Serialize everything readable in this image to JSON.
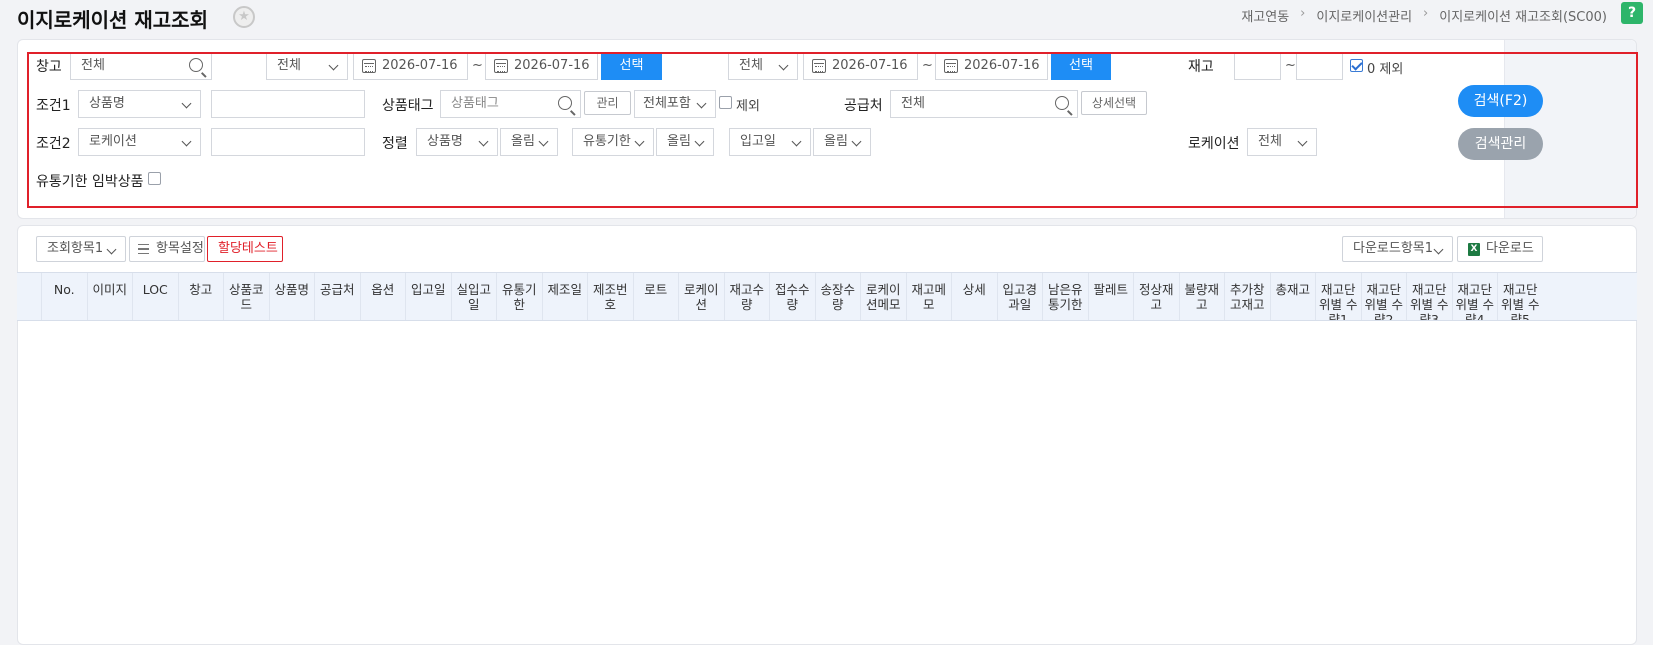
{
  "page": {
    "title": "이지로케이션 재고조회",
    "breadcrumb": [
      "재고연동",
      "이지로케이션관리",
      "이지로케이션 재고조회(SC00)"
    ],
    "help": "?"
  },
  "search": {
    "warehouse_label": "창고",
    "warehouse_value": "전체",
    "date1_type": "전체",
    "date1_from": "2026-07-16",
    "date1_to": "2026-07-16",
    "select1": "선택",
    "date2_type": "전체",
    "date2_from": "2026-07-16",
    "date2_to": "2026-07-16",
    "select2": "선택",
    "stock_label": "재고",
    "stock_tilde": "~",
    "zero_exclude": "0 제외",
    "tilde": "~",
    "cond1_label": "조건1",
    "cond1_value": "상품명",
    "tag_label": "상품태그",
    "tag_placeholder": "상품태그",
    "tag_manage": "관리",
    "tag_scope": "전체포함",
    "tag_exclude": "제외",
    "supplier_label": "공급처",
    "supplier_value": "전체",
    "supplier_detail": "상세선택",
    "cond2_label": "조건2",
    "cond2_value": "로케이션",
    "sort_label": "정렬",
    "sort1": "상품명",
    "sort1_dir": "올림",
    "sort2": "유통기한",
    "sort2_dir": "올림",
    "sort3": "입고일",
    "sort3_dir": "올림",
    "location_label": "로케이션",
    "location_value": "전체",
    "expiry_label": "유통기한 임박상품",
    "search_button": "검색(F2)",
    "search_manage_button": "검색관리"
  },
  "grid": {
    "view_items": "조회항목1",
    "column_settings": "항목설정",
    "allocation_test": "할당테스트",
    "download_items": "다운로드항목1",
    "download": "다운로드",
    "columns": [
      "No.",
      "이미지",
      "LOC",
      "창고",
      "상품코\n드",
      "상품명",
      "공급처",
      "옵션",
      "입고일",
      "실입고\n일",
      "유통기\n한",
      "제조일",
      "제조번\n호",
      "로트",
      "로케이\n션",
      "재고수\n량",
      "접수수\n량",
      "송장수\n량",
      "로케이\n션메모",
      "재고메\n모",
      "상세",
      "입고경\n과일",
      "남은유\n통기한",
      "팔레트",
      "정상재\n고",
      "불량재\n고",
      "추가창\n고재고",
      "총재고",
      "재고단\n위별 수\n량1",
      "재고단\n위별 수\n량2",
      "재고단\n위별 수\n량3",
      "재고단\n위별 수\n량4",
      "재고단\n위별 수\n량5"
    ]
  },
  "colors": {
    "accent": "#1e8df5",
    "highlight": "#e0202a",
    "help": "#2db56a"
  }
}
